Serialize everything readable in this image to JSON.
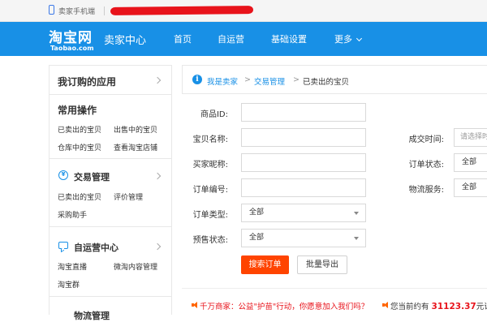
{
  "topbar": {
    "phone_label": "卖家手机端"
  },
  "nav": {
    "logo_cn": "淘宝网",
    "logo_en": "Taobao.com",
    "brand": "卖家中心",
    "items": [
      "首页",
      "自运营",
      "基础设置",
      "更多"
    ]
  },
  "sidebar": {
    "header": "我订购的应用",
    "common_title": "常用操作",
    "common_links": [
      "已卖出的宝贝",
      "出售中的宝贝",
      "仓库中的宝贝",
      "查看淘宝店铺"
    ],
    "trade_title": "交易管理",
    "trade_links": [
      "已卖出的宝贝",
      "评价管理",
      "采购助手"
    ],
    "ops_title": "自运营中心",
    "ops_links": [
      "淘宝直播",
      "微淘内容管理",
      "淘宝群"
    ],
    "next_title": "物流管理"
  },
  "breadcrumb": [
    "我是卖家",
    "交易管理",
    "已卖出的宝贝"
  ],
  "form": {
    "item_id_label": "商品ID:",
    "item_name_label": "宝贝名称:",
    "buyer_label": "买家昵称:",
    "order_no_label": "订单编号:",
    "order_type_label": "订单类型:",
    "order_type_value": "全部",
    "presale_label": "预售状态:",
    "presale_value": "全部",
    "deal_time_label": "成交时间:",
    "deal_time_placeholder": "请选择时间",
    "order_status_label": "订单状态:",
    "order_status_value": "全部",
    "logistics_label": "物流服务:",
    "logistics_value": "全部",
    "search_button": "搜索订单",
    "export_button": "批量导出"
  },
  "notice": {
    "left": "千万商家：公益\"护苗\"行动，你愿意加入我们吗？",
    "right_prefix": "您当前约有",
    "right_amount": "31123.37",
    "right_suffix": "元订"
  },
  "colors": {
    "nav_blue": "#1890e6",
    "primary_orange": "#ff4400",
    "alert_red": "#e8131b"
  }
}
